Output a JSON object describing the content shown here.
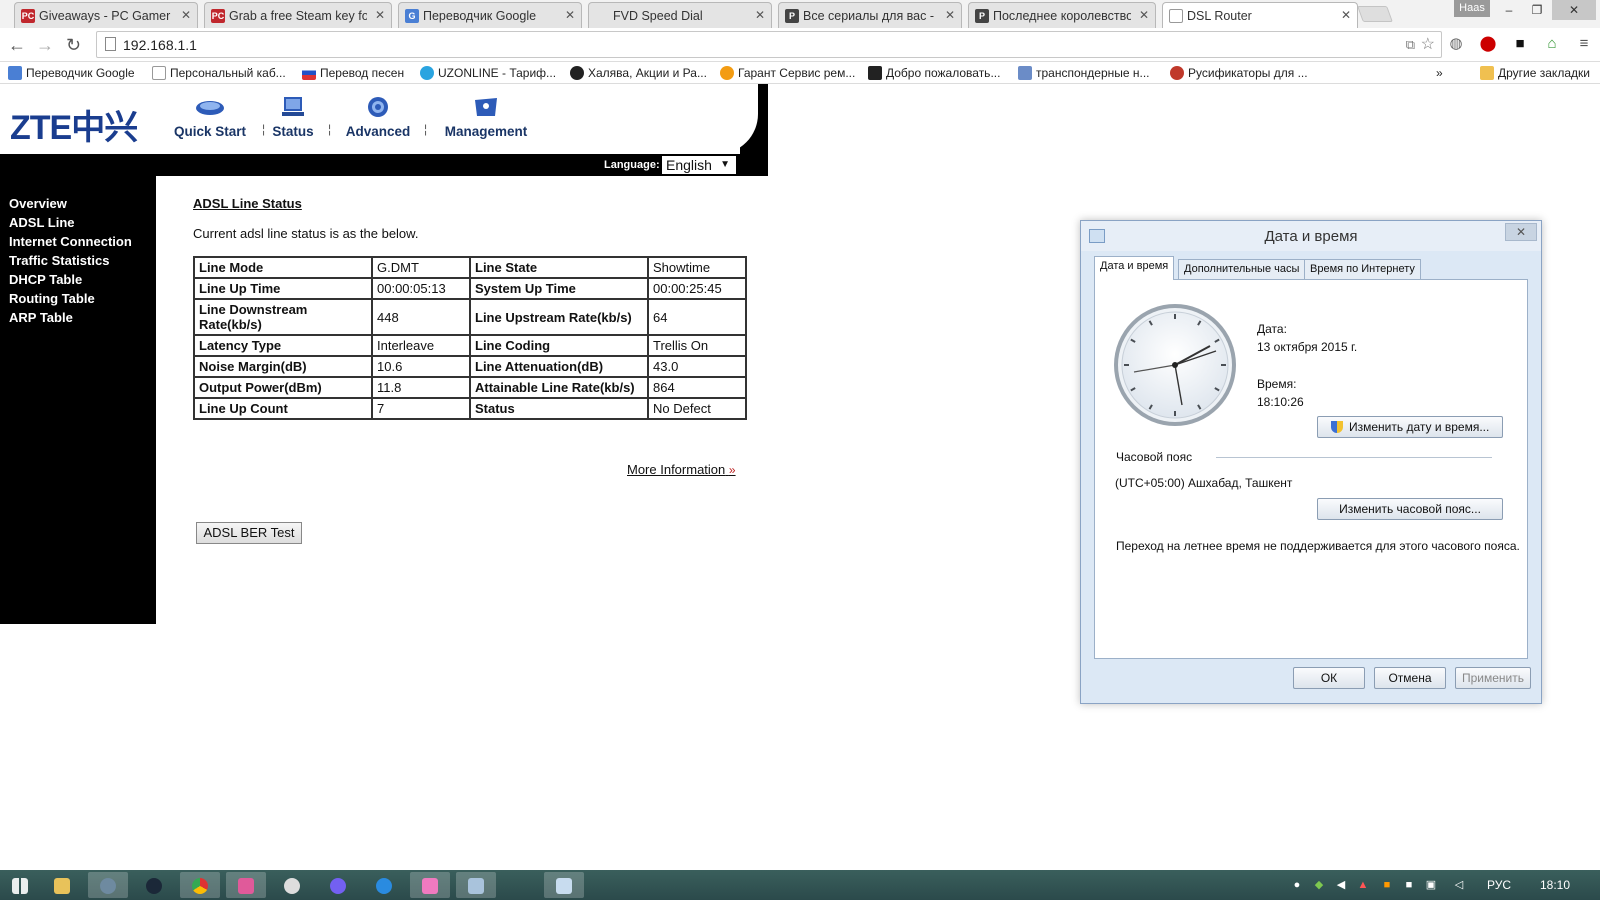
{
  "browser": {
    "tabs": [
      {
        "title": "Giveaways - PC Gamer",
        "favicon_color": "#c0272d",
        "favicon_text": "PC"
      },
      {
        "title": "Grab a free Steam key for",
        "favicon_color": "#c0272d",
        "favicon_text": "PC"
      },
      {
        "title": "Переводчик Google",
        "favicon_color": "#4a7fd4",
        "favicon_text": "G"
      },
      {
        "title": "FVD Speed Dial",
        "favicon_color": "",
        "favicon_text": ""
      },
      {
        "title": "Все сериалы для вас - Pl",
        "favicon_color": "#444",
        "favicon_text": "P"
      },
      {
        "title": "Последнее королевство",
        "favicon_color": "#444",
        "favicon_text": "P"
      },
      {
        "title": "DSL Router",
        "favicon_color": "",
        "favicon_text": ""
      }
    ],
    "user_badge": "Наas",
    "window_buttons": {
      "minimize": "‒",
      "maximize": "❐",
      "close": "✕"
    },
    "url": "192.168.1.1",
    "bookmarks": [
      {
        "label": "Переводчик Google",
        "icon_color": "#4a7fd4"
      },
      {
        "label": "Персональный каб...",
        "icon_color": "#ffffff"
      },
      {
        "label": "Перевод песен",
        "icon_color": "#d33"
      },
      {
        "label": "UZONLINE - Тариф...",
        "icon_color": "#2aa4e0"
      },
      {
        "label": "Халява, Акции и Ра...",
        "icon_color": "#222"
      },
      {
        "label": "Гарант Сервис рем...",
        "icon_color": "#f39c12"
      },
      {
        "label": "Добро пожаловать...",
        "icon_color": "#222"
      },
      {
        "label": "транспондерные н...",
        "icon_color": "#6b8cc7"
      },
      {
        "label": "Русификаторы для ...",
        "icon_color": "#c0392b"
      }
    ],
    "bookmarks_overflow": "»",
    "other_bookmarks": "Другие закладки"
  },
  "router": {
    "logo": "ZTE中兴",
    "top_nav": [
      "Quick Start",
      "Status",
      "Advanced",
      "Management"
    ],
    "language_label": "Language:",
    "language_value": "English",
    "side_nav": [
      "Overview",
      "ADSL Line",
      "Internet Connection",
      "Traffic Statistics",
      "DHCP Table",
      "Routing Table",
      "ARP Table"
    ],
    "page_title": "ADSL Line Status",
    "description": "Current adsl line status is as the below.",
    "table": [
      [
        "Line Mode",
        "G.DMT",
        "Line State",
        "Showtime"
      ],
      [
        "Line Up Time",
        "00:00:05:13",
        "System Up Time",
        "00:00:25:45"
      ],
      [
        "Line Downstream Rate(kb/s)",
        "448",
        "Line Upstream Rate(kb/s)",
        "64"
      ],
      [
        "Latency Type",
        "Interleave",
        "Line Coding",
        "Trellis On"
      ],
      [
        "Noise Margin(dB)",
        "10.6",
        "Line Attenuation(dB)",
        "43.0"
      ],
      [
        "Output Power(dBm)",
        "11.8",
        "Attainable Line Rate(kb/s)",
        "864"
      ],
      [
        "Line Up Count",
        "7",
        "Status",
        "No Defect"
      ]
    ],
    "more_info": "More Information",
    "ber_button": "ADSL BER Test"
  },
  "dialog": {
    "title": "Дата и время",
    "tabs": [
      "Дата и время",
      "Дополнительные часы",
      "Время по Интернету"
    ],
    "date_label": "Дата:",
    "date_value": "13 октября 2015 г.",
    "time_label": "Время:",
    "time_value": "18:10:26",
    "change_datetime": "Изменить дату и время...",
    "timezone_label": "Часовой пояс",
    "timezone_value": "(UTC+05:00) Ашхабад, Ташкент",
    "change_timezone": "Изменить часовой пояс...",
    "dst_note": "Переход на летнее время не поддерживается для этого часового пояса.",
    "ok": "ОК",
    "cancel": "Отмена",
    "apply": "Применить"
  },
  "taskbar": {
    "language": "РУС",
    "time": "18:10"
  }
}
